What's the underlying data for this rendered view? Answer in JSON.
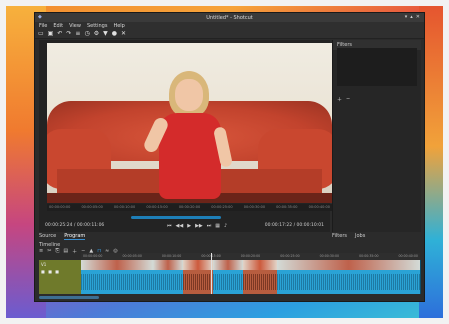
{
  "window": {
    "title": "Untitled* - Shotcut"
  },
  "menu": [
    "File",
    "Edit",
    "View",
    "Settings",
    "Help"
  ],
  "toolbar_icons": [
    "open-icon",
    "save-icon",
    "undo-icon",
    "redo-icon",
    "playlist-icon",
    "history-icon",
    "settings-icon",
    "filter-icon",
    "record-icon",
    "close-icon"
  ],
  "player": {
    "scrub_ticks": [
      "00:00:00:00",
      "00:00:05:00",
      "00:00:10:00",
      "00:00:15:00",
      "00:00:20:00",
      "00:00:25:00",
      "00:00:30:00",
      "00:00:35:00",
      "00:00:40:00"
    ],
    "current_timecode": "00:00:25:24",
    "duration": "/ 00:00:11:06",
    "in_out": "00:00:17:22 / 00:00:10:01",
    "tabs": [
      "Source",
      "Program"
    ],
    "active_tab": "Program"
  },
  "right_panel": {
    "title": "Filters",
    "tabs": [
      "Filters",
      "Jobs"
    ]
  },
  "timeline": {
    "label": "Timeline",
    "track_name": "V1",
    "ruler_ticks": [
      "00:00:00:00",
      "00:00:05:00",
      "00:00:10:00",
      "00:00:15:00",
      "00:00:20:00",
      "00:00:25:00",
      "00:00:30:00",
      "00:00:35:00",
      "00:00:40:00"
    ]
  }
}
